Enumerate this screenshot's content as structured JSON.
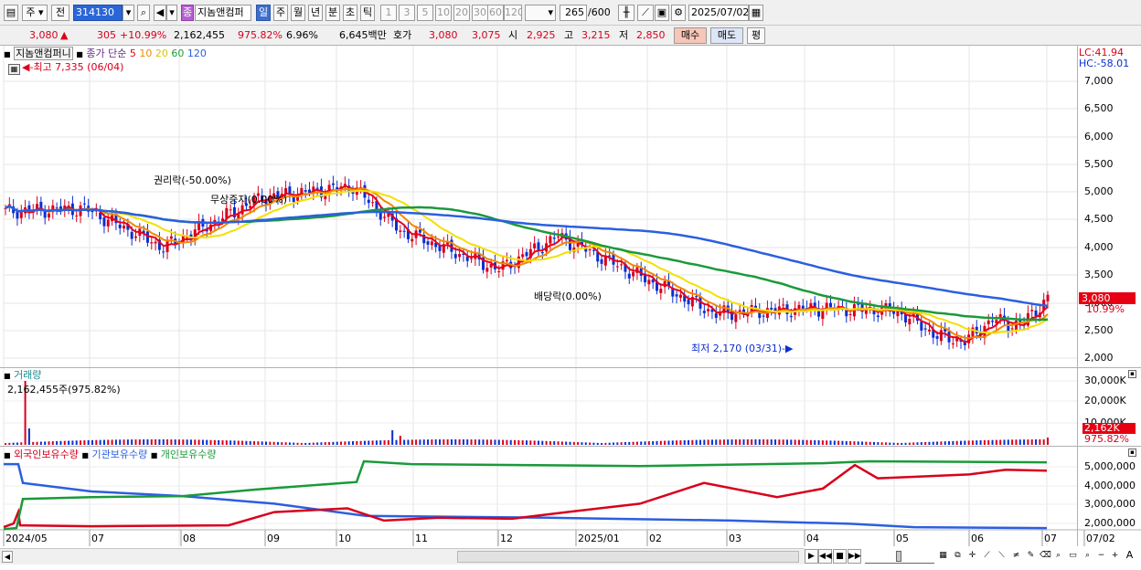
{
  "toolbar": {
    "market_label": "주",
    "prev_label": "전",
    "stock_code": "314130",
    "stock_name": "지놈앤컴퍼",
    "period_day": "일",
    "period_week": "주",
    "period_month": "월",
    "period_year": "년",
    "period_min": "분",
    "period_sec": "초",
    "period_tick": "틱",
    "intervals": [
      "1",
      "3",
      "5",
      "10",
      "20",
      "30",
      "60",
      "120"
    ],
    "count_value": "265",
    "count_total": "/600",
    "date_value": "2025/07/02"
  },
  "quote": {
    "price": "3,080",
    "change": "305",
    "change_pct": "+10.99%",
    "volume": "2,162,455",
    "volume_ratio": "975.82%",
    "turnover": "6.96%",
    "amount": "6,645백만",
    "bid_label": "호가",
    "bid": "3,080",
    "ask": "3,075",
    "open_label": "시",
    "open": "2,925",
    "high_label": "고",
    "high": "3,215",
    "low_label": "저",
    "low": "2,850",
    "buy_label": "매수",
    "sell_label": "매도",
    "eval_label": "평"
  },
  "price_panel": {
    "title": "지놈앤컴퍼니",
    "ma_label": "종가 단순",
    "ma_periods": [
      "5",
      "10",
      "20",
      "60",
      "120"
    ],
    "high_annot": "최고 7,335 (06/04)",
    "low_annot": "최저 2,170 (03/31)",
    "event_rights": "권리락(-50.00%)",
    "event_bonus": "무상증자(0.00%)",
    "event_dividend": "배당락(0.00%)",
    "lc_label": "LC:41.94",
    "hc_label": "HC:-58.01",
    "last_price": "3,080",
    "last_pct": "10.99%",
    "y_ticks": [
      "7,000",
      "6,500",
      "6,000",
      "5,500",
      "5,000",
      "4,500",
      "4,000",
      "3,500",
      "3,000",
      "2,500",
      "2,000"
    ]
  },
  "volume_panel": {
    "title": "거래량",
    "value_text": "2,162,455주(975.82%)",
    "y_ticks": [
      "30,000K",
      "20,000K",
      "10,000K"
    ],
    "last_value": "2,162K",
    "last_pct": "975.82%"
  },
  "holding_panel": {
    "series_labels": [
      "외국인보유수량",
      "기관보유수량",
      "개인보유수량"
    ],
    "y_ticks": [
      "5,000,000",
      "4,000,000",
      "3,000,000",
      "2,000,000"
    ]
  },
  "x_axis": {
    "labels": [
      "2024/05",
      "07",
      "08",
      "09",
      "10",
      "11",
      "12",
      "2025/01",
      "02",
      "03",
      "04",
      "05",
      "06",
      "07",
      "07/02"
    ]
  },
  "colors": {
    "up": "#d8001c",
    "down": "#0a2fd0",
    "ma5": "#e8001c",
    "ma10": "#f08a00",
    "ma20": "#f3e000",
    "ma60": "#1a9a3a",
    "ma120": "#2b5fe0",
    "foreign": "#d8001c",
    "institution": "#2b5fe0",
    "individual": "#1a9a3a"
  }
}
